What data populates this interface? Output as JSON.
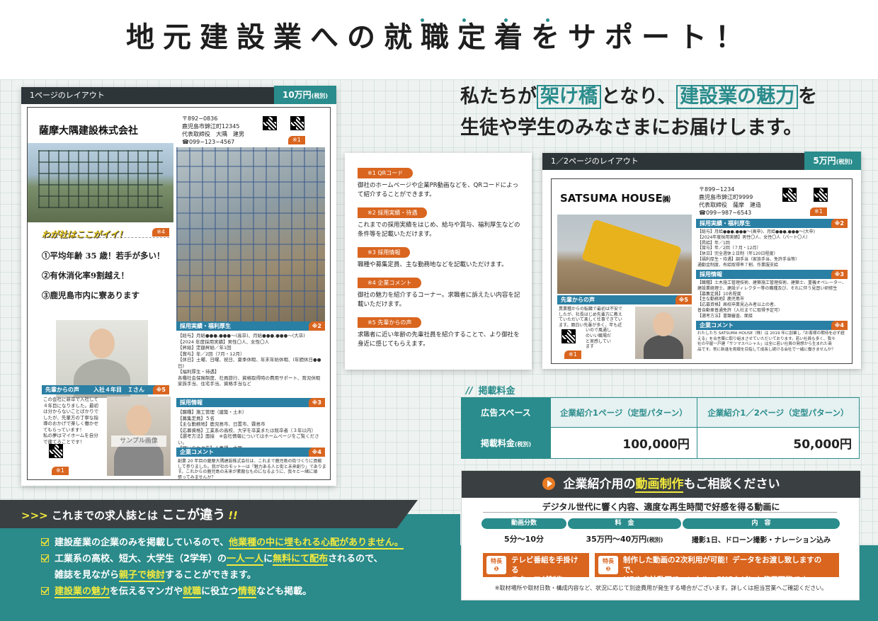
{
  "headline": "地元建設業への就職定着をサポート！",
  "tagline": {
    "p1": "私たちが",
    "hl1": "架け橋",
    "p2": "となり、",
    "hl2": "建設業の魅力",
    "p3": "を",
    "line2": "生徒や学生のみなさまにお届けします。"
  },
  "layout1": {
    "title": "1ページのレイアウト",
    "price": "10万円",
    "price_note": "(税別)",
    "company": "薩摩大隅建設株式会社",
    "postal": "〒892−0836",
    "address": "鹿児島市錦江町12345",
    "rep": "代表取締役　大隅　建男",
    "tel": "☎099−123−4567",
    "qr_badge": "※1",
    "appeal_title": "わが社はここがイイ！",
    "appeal_badge": "※4",
    "appeal_items": [
      "①平均年齢 35 歳！若手が多い！",
      "②有休消化率9割越え！",
      "③鹿児島市内に寮あります"
    ],
    "sec_jobs": "採用実績・福利厚生",
    "sec_jobs_n": "※2",
    "jobs_lines": [
      "【総与】月給●●●,●●●〜(高卒)、月給●●●,●●●〜(大卒)",
      "【2024 年度採用実績】男性〇人、女性〇人",
      "【昇給】定額昇給／年1回",
      "【賞与】年／2回（7月・12月）",
      "【休日】土曜、日曜、祝日、夏季休暇、年末年始休暇、(年間休日●●日)",
      "【福利厚生・待遇】",
      "各種社会保険制度、社員旅行、資格取得時の費用サポート、育児休暇",
      "家族手当、住宅手当、資格手当など"
    ],
    "sec_voice": "先輩からの声",
    "voice_sub": "入社４年目　Ｉさん",
    "voice_n": "※5",
    "voice_lines": [
      "この会社に新卒で入社して",
      "４年目になりました。最初",
      "は分からないことばかりで",
      "したが、先輩方の丁寧な指",
      "導のおかげで楽しく働かせ",
      "てもらっています！",
      "私の夢はマイホームを自分",
      "で建てることです！"
    ],
    "voice_qr_badge": "※1",
    "sample_label": "サンプル画像",
    "sec_info": "採用情報",
    "sec_info_n": "※3",
    "info_lines": [
      "【職種】施工管理（建築・土木）",
      "【募集定員】５名",
      "【主な勤務地】鹿児島市、日置市、霧島市",
      "【応募資格】工業系の高校、大学を卒業または既卒者（３年以内）",
      "【選考方法】面接　※会社情報についてはホームページをご覧ください。",
      "【問い合わせ先】人事課　大隅"
    ],
    "sec_comment": "企業コメント",
    "sec_comment_n": "※4",
    "comment_lines": [
      "創業 20 年目の薩摩大隅建設株式会社は、これまで鹿児島の街づくりに貢献",
      "して参りました。我が社のモットーは「魅力ある人と街と未来創り」でありま",
      "す。これからの鹿児島の未来が素敵なものになるように、我々と一緒に頑",
      "張ってみませんか？"
    ]
  },
  "explain": [
    {
      "label": "※1 QRコード",
      "text": "御社のホームページや企業PR動画などを、QRコードによって紹介することができます。"
    },
    {
      "label": "※2 採用実績・待遇",
      "text": "これまでの採用実績をはじめ、給与や賞与、福利厚生などの条件等を記載いただけます。"
    },
    {
      "label": "※3 採用情報",
      "text": "職種や募集定員、主な勤務地などを記載いただけます。"
    },
    {
      "label": "※4 企業コメント",
      "text": "御社の魅力を紹介するコーナー。求職者に訴えたい内容を記載いただけます。"
    },
    {
      "label": "※5 先輩からの声",
      "text": "求職者に近い年齢の先輩社員を紹介することで、より御社を身近に感じてもらえます。"
    }
  ],
  "layout2": {
    "title": "1／2ページのレイアウト",
    "price": "5万円",
    "price_note": "(税別)",
    "company": "SATSUMA HOUSE",
    "company_suffix": "㈱",
    "postal": "〒899−1234",
    "address": "鹿児島市錦江町9999",
    "rep": "代表取締役　薩摩　建造",
    "tel": "☎099−987−6543",
    "qr_badge": "※1",
    "sec_jobs": "採用実績・福利厚生",
    "sec_jobs_n": "※2",
    "jobs_lines": [
      "【総与】月給●●●,●●●〜(高卒)、月給●●●,●●●〜(大卒)",
      "【2024年度採用実績】男性〇人、女性〇人（パート〇人）",
      "【昇給】年／1回",
      "【賞与】年／2回（７月・12月）",
      "【休日】完全週休２日制（年120日程度）",
      "【福利厚生・待遇】調手当（家族手当、免許手当等）",
      "通勤金制度、有給取得率７割、作業服支給"
    ],
    "sec_info": "採用情報",
    "sec_info_n": "※3",
    "info_lines": [
      "【職種】土木施工管理技術、建築施工管理技術、建築士、重機オペレーター、",
      "建設業経理士、建設ディレクター等の職種及び、それに伴う見習い研修生",
      "【募集定員】10名程度",
      "【主な勤務地】鹿児島市",
      "【応募資格】高校卒業見込み者以上の者、",
      "普自動車普通免許（入社までに取得予定可）",
      "【選考方法】書類審査、面接"
    ],
    "sec_voice": "先輩からの声",
    "voice_n": "※5",
    "voice_lines": [
      "異業種からの転職で最初は不安で",
      "したが、社長はじめ先輩方に教え",
      "ていただいて楽しく仕事できてい",
      "ます。面白い先輩が多く、年も近",
      "いので風通し",
      "のいい職場だ",
      "と実感してい",
      "ます"
    ],
    "voice_qr_badge": "※1",
    "sec_comment": "企業コメント",
    "sec_comment_n": "※4",
    "comment_lines": [
      "わたしたち SATSUMA HOUSE（株）は 2019 年に創業し「お客様の期待を必ず超",
      "える」を合言葉に取り組まさせていただいております。若い社員も多く、我々",
      "社の平屋一戸建「サツマスペシャル」は全に若い社員の発想から生まれた商",
      "品です。常に新進を挑戦を目指して成長し続ける会社で一緒に働きませんか？"
    ]
  },
  "fees": {
    "heading": "掲載料金",
    "col_label": "広告スペース",
    "col_full": "企業紹介1ページ（定型パターン）",
    "col_half": "企業紹介1／2ページ（定型パターン）",
    "row_label": "掲載料金",
    "row_note": "(税別)",
    "price_full": "100,000円",
    "price_half": "50,000円"
  },
  "video": {
    "p1": "企業紹介用の",
    "hl": "動画制作",
    "p2": "もご相談ください",
    "subtitle": "デジタル世代に響く内容、適度な再生時間で好感を得る動画に",
    "cols": [
      {
        "label": "動画分数",
        "value": "5分〜10分"
      },
      {
        "label": "料　金",
        "value": "35万円〜40万円",
        "note": "(税別)"
      },
      {
        "label": "内　容",
        "value": "撮影1日、ドローン撮影・ナレーション込み"
      }
    ],
    "feature1_badge": "特長",
    "feature1_num": "❶",
    "feature1": [
      "テレビ番組を手掛ける",
      "スタッフが制作。"
    ],
    "feature2_badge": "特長",
    "feature2_num": "❷",
    "feature2": [
      "制作した動画の2次利用が可能！データをお渡し致しますので、",
      "HPや自社動画チャンネル、SNSなどにも使用可能です。"
    ],
    "footnote": "※取材場所や取材日数・構成内容など、状況に応じて別途費用が発生する場合がございます。詳しくは担当営業へご確認ください。"
  },
  "difference": {
    "arrows": ">>>",
    "p1": "これまでの求人誌とは",
    "p2": "ここが違う",
    "mark": "!!",
    "b1": {
      "t1": "建設産業の企業のみを掲載しているので、",
      "h1": "他業種の中に",
      "h2": "埋もれる心配がありません。"
    },
    "b2": {
      "t1": "工業系の高校、短大、大学生（2学年）の",
      "h1": "一人一人",
      "t2": "に",
      "h2": "無料にて配布",
      "t3": "されるので、",
      "line2a": "雑誌を見ながら",
      "h3": "親子で検討",
      "line2b": "することができます。"
    },
    "b3": {
      "h1": "建設業の魅力",
      "t1": "を伝えるマンガや",
      "h2": "就職",
      "t2": "に役立つ",
      "h3": "情報",
      "t3": "なども掲載。"
    }
  }
}
